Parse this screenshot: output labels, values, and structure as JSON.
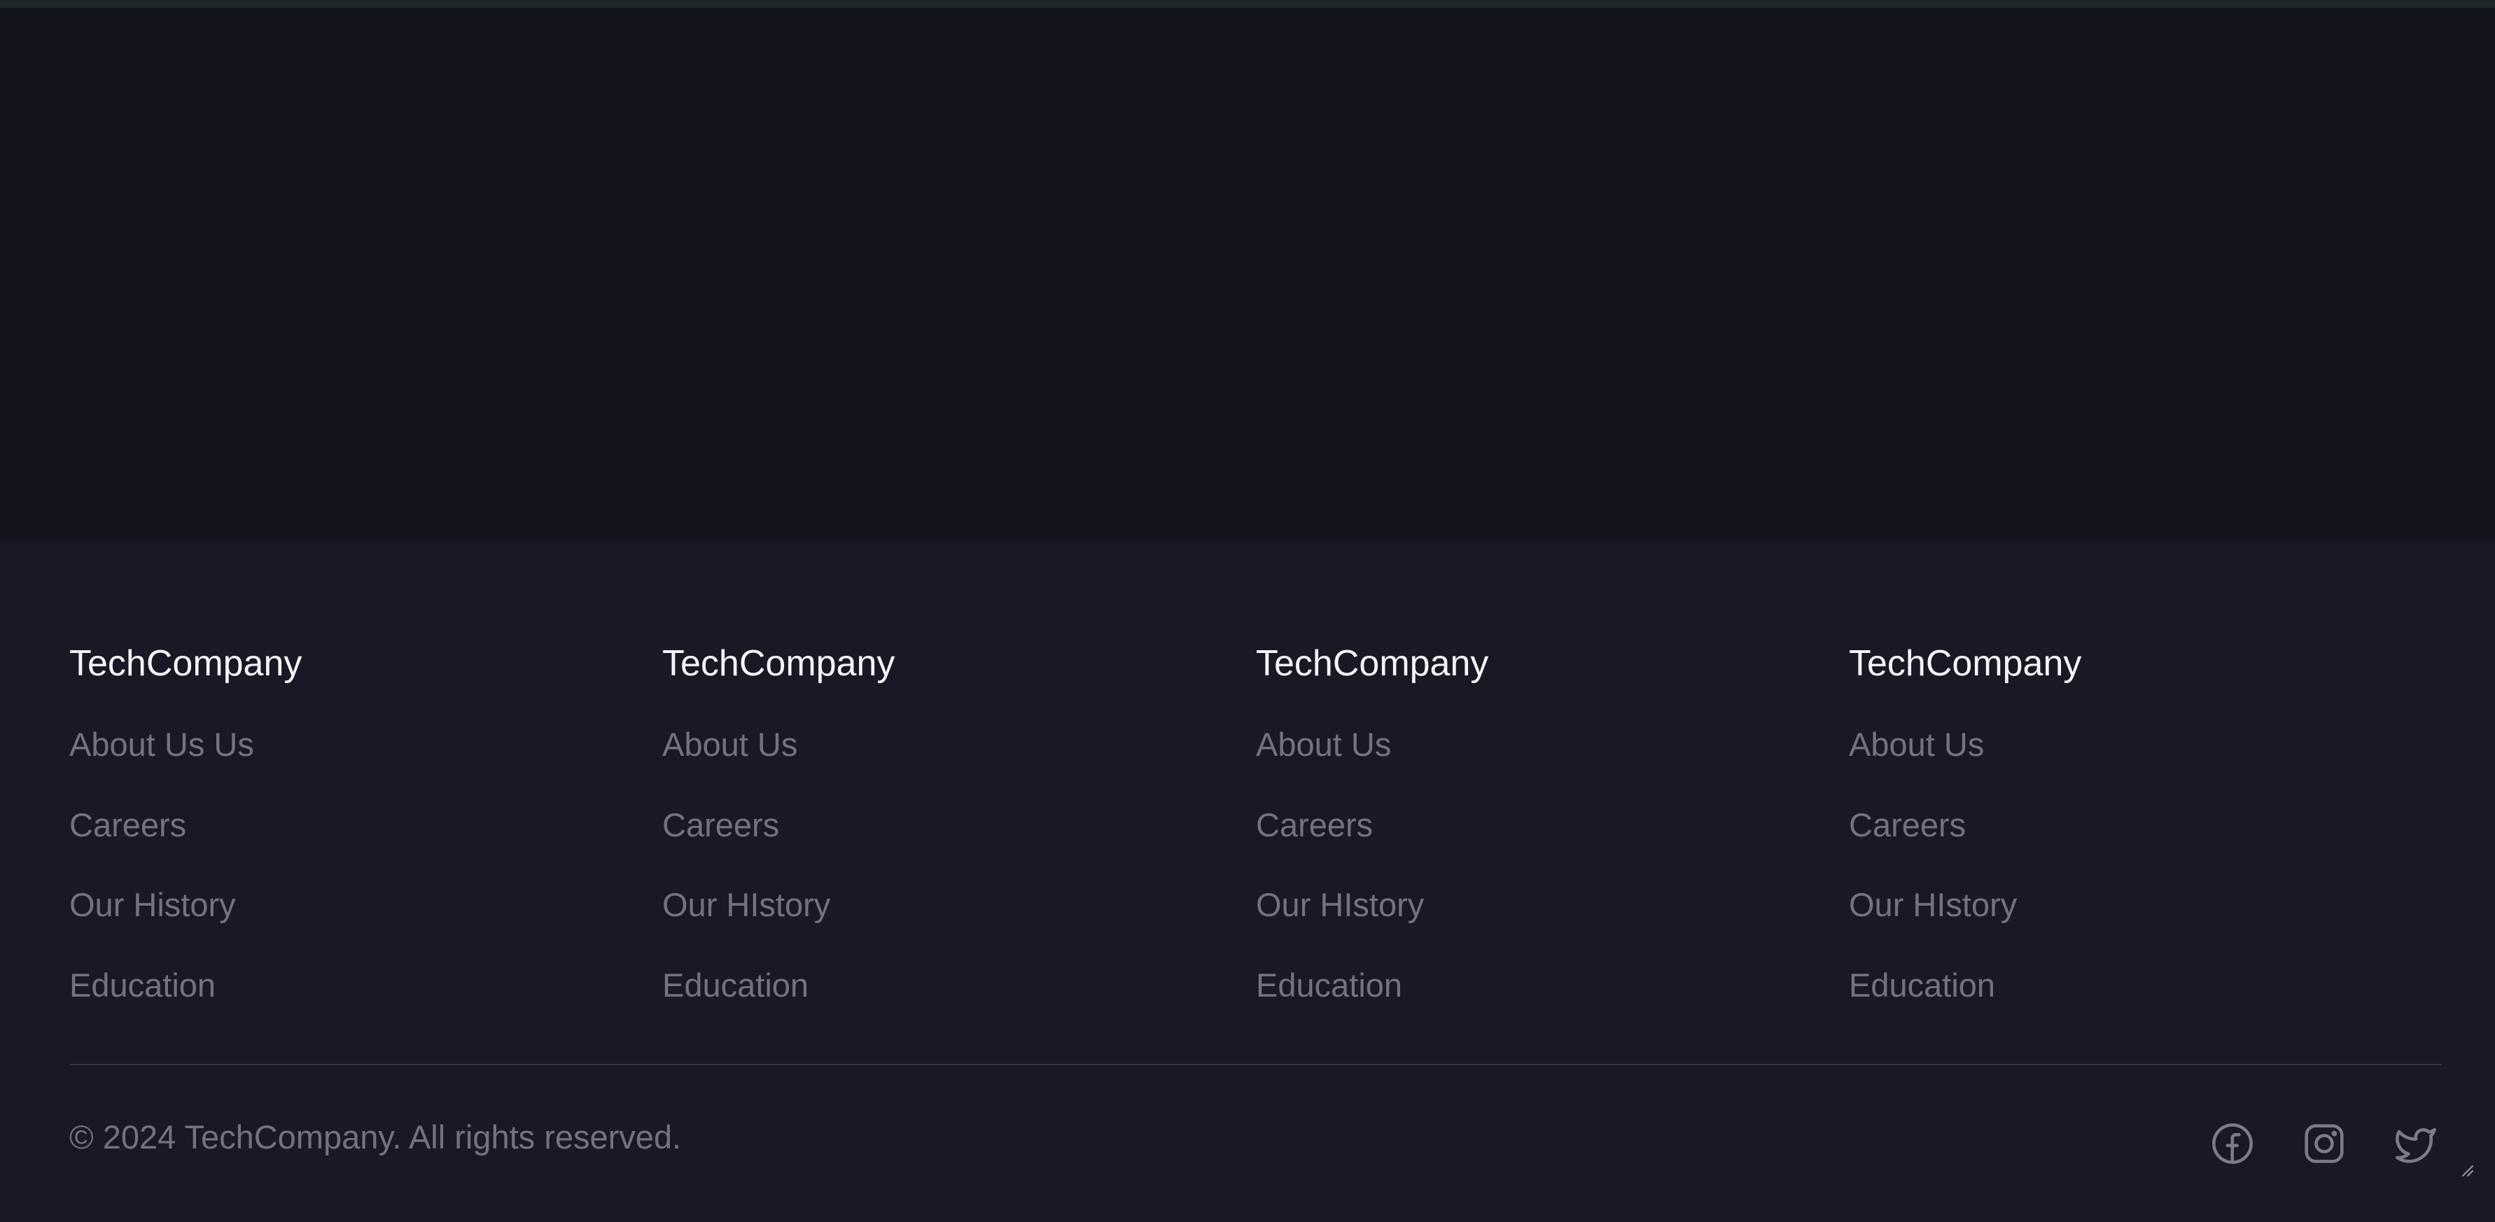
{
  "footer": {
    "columns": [
      {
        "title": "TechCompany",
        "links": [
          "About Us Us",
          "Careers",
          "Our History",
          "Education"
        ]
      },
      {
        "title": "TechCompany",
        "links": [
          "About Us",
          "Careers",
          "Our HIstory",
          "Education"
        ]
      },
      {
        "title": "TechCompany",
        "links": [
          "About Us",
          "Careers",
          "Our HIstory",
          "Education"
        ]
      },
      {
        "title": "TechCompany",
        "links": [
          "About Us",
          "Careers",
          "Our HIstory",
          "Education"
        ]
      }
    ],
    "copyright": "© 2024 TechCompany. All rights reserved.",
    "social": [
      {
        "icon": "facebook-icon"
      },
      {
        "icon": "instagram-icon"
      },
      {
        "icon": "twitter-icon"
      }
    ]
  },
  "colors": {
    "page_background": "#14141d",
    "footer_background": "#181924",
    "top_strip": "#202729",
    "title_text": "#f4f4f6",
    "link_text": "#737380",
    "divider": "#34353f"
  }
}
